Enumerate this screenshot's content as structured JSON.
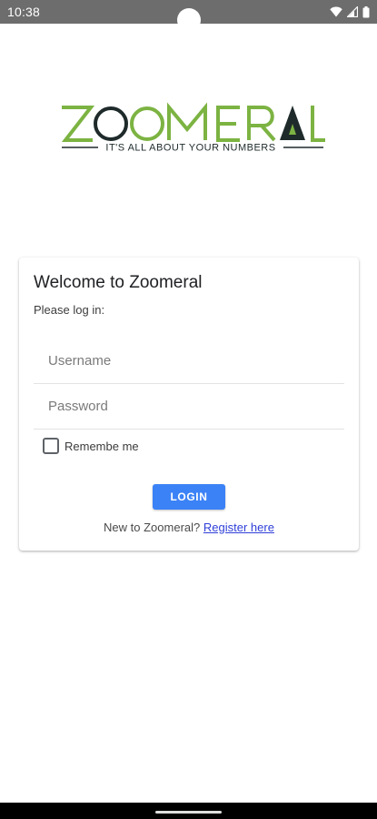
{
  "status_bar": {
    "time": "10:38",
    "icons": [
      "wifi-icon",
      "signal-icon",
      "battery-icon"
    ]
  },
  "logo": {
    "text": "ZOOMERAL",
    "tagline": "IT'S ALL ABOUT YOUR NUMBERS",
    "green": "#7cb342",
    "dark": "#1f2a2a"
  },
  "login_card": {
    "title": "Welcome to Zoomeral",
    "subtitle": "Please log in:",
    "username_placeholder": "Username",
    "username_value": "",
    "password_placeholder": "Password",
    "password_value": "",
    "remember_label": "Remembe me",
    "remember_checked": false,
    "login_label": "LOGIN",
    "register_prompt": "New to Zoomeral?",
    "register_link": "Register here"
  },
  "colors": {
    "status_bar": "#6d6d6d",
    "primary_button": "#3b82f6",
    "link": "#2f3fd8"
  }
}
